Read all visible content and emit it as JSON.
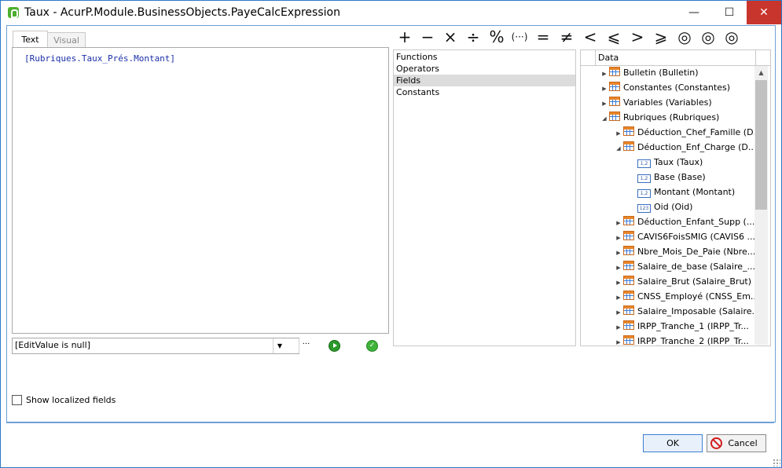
{
  "window": {
    "title": "Taux - AcurP.Module.BusinessObjects.PayeCalcExpression",
    "minimize_glyph": "—",
    "maximize_glyph": "☐",
    "close_glyph": "✕"
  },
  "editor": {
    "tabs": [
      {
        "label": "Text",
        "active": true
      },
      {
        "label": "Visual",
        "active": false
      }
    ],
    "expression": "[Rubriques.Taux_Prés.Montant]",
    "combo_value": "[EditValue is null]",
    "combo_arrow": "▼",
    "combo_ellipsis": "···"
  },
  "operators": [
    {
      "name": "plus",
      "symbol": "+"
    },
    {
      "name": "minus",
      "symbol": "−"
    },
    {
      "name": "multiply",
      "symbol": "×"
    },
    {
      "name": "divide",
      "symbol": "÷"
    },
    {
      "name": "modulo",
      "symbol": "%"
    },
    {
      "name": "parentheses",
      "symbol": "(···)"
    },
    {
      "name": "equal",
      "symbol": "="
    },
    {
      "name": "not-equal",
      "symbol": "≠"
    },
    {
      "name": "less",
      "symbol": "<"
    },
    {
      "name": "less-or-equal",
      "symbol": "⩽"
    },
    {
      "name": "greater",
      "symbol": ">"
    },
    {
      "name": "greater-or-equal",
      "symbol": "⩾"
    },
    {
      "name": "and",
      "symbol": "◎"
    },
    {
      "name": "or",
      "symbol": "◎"
    },
    {
      "name": "not",
      "symbol": "◎"
    }
  ],
  "categories": [
    {
      "label": "Functions",
      "selected": false
    },
    {
      "label": "Operators",
      "selected": false
    },
    {
      "label": "Fields",
      "selected": true
    },
    {
      "label": "Constants",
      "selected": false
    }
  ],
  "tree": {
    "header": "Data",
    "rows": [
      {
        "label": "Bulletin (Bulletin)",
        "level": 0,
        "expander": "▶",
        "icon": "table"
      },
      {
        "label": "Constantes (Constantes)",
        "level": 0,
        "expander": "▶",
        "icon": "table"
      },
      {
        "label": "Variables (Variables)",
        "level": 0,
        "expander": "▶",
        "icon": "table"
      },
      {
        "label": "Rubriques (Rubriques)",
        "level": 0,
        "expander": "◢",
        "icon": "table"
      },
      {
        "label": "Déduction_Chef_Famille (D...",
        "level": 1,
        "expander": "▶",
        "icon": "table"
      },
      {
        "label": "Déduction_Enf_Charge (D...",
        "level": 1,
        "expander": "◢",
        "icon": "table"
      },
      {
        "label": "Taux (Taux)",
        "level": 2,
        "expander": "",
        "icon": "1,2"
      },
      {
        "label": "Base (Base)",
        "level": 2,
        "expander": "",
        "icon": "1,2"
      },
      {
        "label": "Montant (Montant)",
        "level": 2,
        "expander": "",
        "icon": "1,2"
      },
      {
        "label": "Oid (Oid)",
        "level": 2,
        "expander": "",
        "icon": "123"
      },
      {
        "label": "Déduction_Enfant_Supp (...",
        "level": 1,
        "expander": "▶",
        "icon": "table"
      },
      {
        "label": "CAVIS6FoisSMIG (CAVIS6 ...",
        "level": 1,
        "expander": "▶",
        "icon": "table"
      },
      {
        "label": "Nbre_Mois_De_Paie (Nbre...",
        "level": 1,
        "expander": "▶",
        "icon": "table"
      },
      {
        "label": "Salaire_de_base (Salaire_...",
        "level": 1,
        "expander": "▶",
        "icon": "table"
      },
      {
        "label": "Salaire_Brut (Salaire_Brut)",
        "level": 1,
        "expander": "▶",
        "icon": "table"
      },
      {
        "label": "CNSS_Employé (CNSS_Em...",
        "level": 1,
        "expander": "▶",
        "icon": "table"
      },
      {
        "label": "Salaire_Imposable (Salaire...",
        "level": 1,
        "expander": "▶",
        "icon": "table"
      },
      {
        "label": "IRPP_Tranche_1 (IRPP_Tr...",
        "level": 1,
        "expander": "▶",
        "icon": "table"
      },
      {
        "label": "IRPP_Tranche_2 (IRPP_Tr...",
        "level": 1,
        "expander": "▶",
        "icon": "table"
      }
    ]
  },
  "options": {
    "show_localized_fields": "Show localized fields",
    "checked": false
  },
  "footer": {
    "ok_label": "OK",
    "cancel_label": "Cancel"
  },
  "colors": {
    "accent": "#2b79c9",
    "expression_text": "#1b2fa8",
    "close_button": "#c8352c"
  }
}
